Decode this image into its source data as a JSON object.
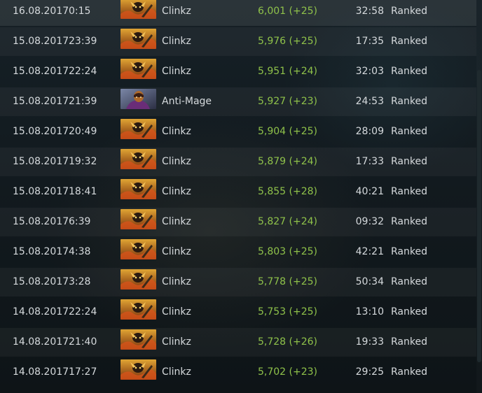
{
  "matches": [
    {
      "date": "16.08.2017",
      "time": "0:15",
      "hero": "Clinkz",
      "hero_icon": "clinkz-portrait",
      "mmr": "6,001 (+25)",
      "duration": "32:58",
      "type": "Ranked"
    },
    {
      "date": "15.08.2017",
      "time": "23:39",
      "hero": "Clinkz",
      "hero_icon": "clinkz-portrait",
      "mmr": "5,976 (+25)",
      "duration": "17:35",
      "type": "Ranked"
    },
    {
      "date": "15.08.2017",
      "time": "22:24",
      "hero": "Clinkz",
      "hero_icon": "clinkz-portrait",
      "mmr": "5,951 (+24)",
      "duration": "32:03",
      "type": "Ranked"
    },
    {
      "date": "15.08.2017",
      "time": "21:39",
      "hero": "Anti-Mage",
      "hero_icon": "anti-mage-portrait",
      "mmr": "5,927 (+23)",
      "duration": "24:53",
      "type": "Ranked"
    },
    {
      "date": "15.08.2017",
      "time": "20:49",
      "hero": "Clinkz",
      "hero_icon": "clinkz-portrait",
      "mmr": "5,904 (+25)",
      "duration": "28:09",
      "type": "Ranked"
    },
    {
      "date": "15.08.2017",
      "time": "19:32",
      "hero": "Clinkz",
      "hero_icon": "clinkz-portrait",
      "mmr": "5,879 (+24)",
      "duration": "17:33",
      "type": "Ranked"
    },
    {
      "date": "15.08.2017",
      "time": "18:41",
      "hero": "Clinkz",
      "hero_icon": "clinkz-portrait",
      "mmr": "5,855 (+28)",
      "duration": "40:21",
      "type": "Ranked"
    },
    {
      "date": "15.08.2017",
      "time": "6:39",
      "hero": "Clinkz",
      "hero_icon": "clinkz-portrait",
      "mmr": "5,827 (+24)",
      "duration": "09:32",
      "type": "Ranked"
    },
    {
      "date": "15.08.2017",
      "time": "4:38",
      "hero": "Clinkz",
      "hero_icon": "clinkz-portrait",
      "mmr": "5,803 (+25)",
      "duration": "42:21",
      "type": "Ranked"
    },
    {
      "date": "15.08.2017",
      "time": "3:28",
      "hero": "Clinkz",
      "hero_icon": "clinkz-portrait",
      "mmr": "5,778 (+25)",
      "duration": "50:34",
      "type": "Ranked"
    },
    {
      "date": "14.08.2017",
      "time": "22:24",
      "hero": "Clinkz",
      "hero_icon": "clinkz-portrait",
      "mmr": "5,753 (+25)",
      "duration": "13:10",
      "type": "Ranked"
    },
    {
      "date": "14.08.2017",
      "time": "21:40",
      "hero": "Clinkz",
      "hero_icon": "clinkz-portrait",
      "mmr": "5,728 (+26)",
      "duration": "19:33",
      "type": "Ranked"
    },
    {
      "date": "14.08.2017",
      "time": "17:27",
      "hero": "Clinkz",
      "hero_icon": "clinkz-portrait",
      "mmr": "5,702 (+23)",
      "duration": "29:25",
      "type": "Ranked"
    }
  ],
  "colors": {
    "background": "#0f1518",
    "text": "#d6dadd",
    "mmr_gain": "#8fc24a",
    "row_alt": "rgba(255,255,255,0.045)"
  }
}
